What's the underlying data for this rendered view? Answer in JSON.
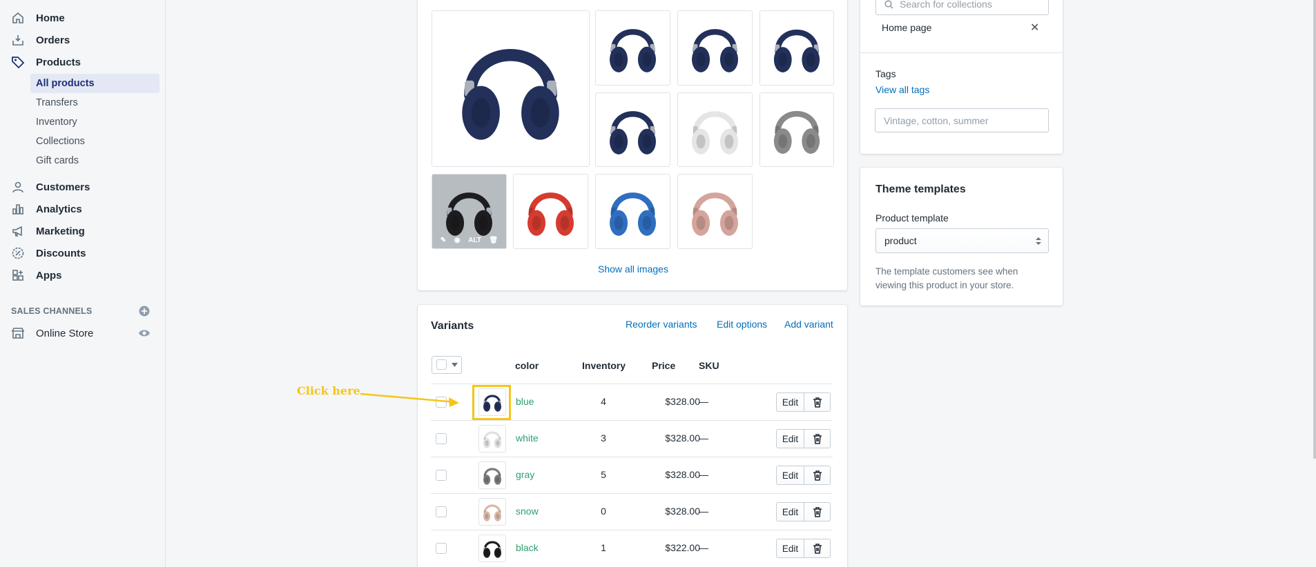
{
  "sidebar": {
    "nav": [
      {
        "label": "Home",
        "icon": "home-icon"
      },
      {
        "label": "Orders",
        "icon": "orders-icon"
      },
      {
        "label": "Products",
        "icon": "tag-icon"
      }
    ],
    "products_sub": [
      "All products",
      "Transfers",
      "Inventory",
      "Collections",
      "Gift cards"
    ],
    "nav2": [
      {
        "label": "Customers",
        "icon": "customers-icon"
      },
      {
        "label": "Analytics",
        "icon": "analytics-icon"
      },
      {
        "label": "Marketing",
        "icon": "marketing-icon"
      },
      {
        "label": "Discounts",
        "icon": "discounts-icon"
      },
      {
        "label": "Apps",
        "icon": "apps-icon"
      }
    ],
    "sales_channels_title": "SALES CHANNELS",
    "online_store": "Online Store"
  },
  "images": {
    "show_all": "Show all images",
    "alt_label": "ALT",
    "colors": [
      "#22305a",
      "#22305a",
      "#22305a",
      "#22305a",
      "#22305a",
      "#e5e5e5",
      "#8a8a8a",
      "#1d1d1f",
      "#d63b2f",
      "#2f6ec0",
      "#d4a59c"
    ]
  },
  "variants": {
    "title": "Variants",
    "actions": [
      "Reorder variants",
      "Edit options",
      "Add variant"
    ],
    "headers": {
      "color": "color",
      "inventory": "Inventory",
      "price": "Price",
      "sku": "SKU"
    },
    "edit_label": "Edit",
    "rows": [
      {
        "name": "blue",
        "inventory": "4",
        "price": "$328.00",
        "sku": "—",
        "swatch": "#22305a"
      },
      {
        "name": "white",
        "inventory": "3",
        "price": "$328.00",
        "sku": "—",
        "swatch": "#e0e0e0"
      },
      {
        "name": "gray",
        "inventory": "5",
        "price": "$328.00",
        "sku": "—",
        "swatch": "#7a7a7a"
      },
      {
        "name": "snow",
        "inventory": "0",
        "price": "$328.00",
        "sku": "—",
        "swatch": "#d8b8a8"
      },
      {
        "name": "black",
        "inventory": "1",
        "price": "$322.00",
        "sku": "—",
        "swatch": "#1d1d1f"
      }
    ]
  },
  "organization": {
    "search_placeholder": "Search for collections",
    "collection_tag": "Home page",
    "tags_label": "Tags",
    "view_all_tags": "View all tags",
    "tags_placeholder": "Vintage, cotton, summer"
  },
  "theme": {
    "title": "Theme templates",
    "template_label": "Product template",
    "template_value": "product",
    "help": [
      "The template customers see when",
      "viewing this product in your store."
    ]
  },
  "annotation": {
    "text": "Click here",
    "color": "#f5c518"
  }
}
